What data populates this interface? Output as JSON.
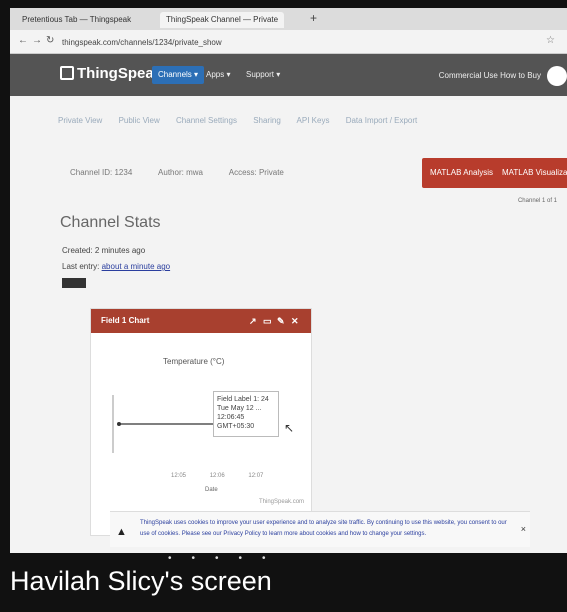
{
  "browser": {
    "tabs": [
      {
        "label": "Pretentious Tab — Thingspeak",
        "active": false
      },
      {
        "label": "ThingSpeak Channel — Private",
        "active": true
      }
    ],
    "new_tab_label": "+",
    "url": "thingspeak.com/channels/1234/private_show"
  },
  "appbar": {
    "logo": "ThingSpeak™",
    "channels_label": "Channels ▾",
    "apps_label": "Apps ▾",
    "support_label": "Support ▾",
    "commercial_label": "Commercial Use   How to Buy"
  },
  "subtabs": [
    "Private View",
    "Public View",
    "Channel Settings",
    "Sharing",
    "API Keys",
    "Data Import / Export"
  ],
  "channel_info": [
    "Channel ID: 1234",
    "Author: mwa",
    "Access: Private"
  ],
  "buttons": {
    "matlab_analysis": "MATLAB Analysis",
    "matlab_visualization": "MATLAB Visualization"
  },
  "export_label": "Channel 1 of 1",
  "stats": {
    "title": "Channel Stats",
    "created_label": "Created:",
    "created_value": "2 minutes ago",
    "entries_label": "Last entry:",
    "entries_value": "about a minute ago"
  },
  "widget": {
    "title": "Field 1 Chart",
    "chart_title": "Temperature (°C)",
    "x_label": "Date",
    "credit": "ThingSpeak.com",
    "x_ticks": [
      "12:05",
      "12:06",
      "12:07"
    ],
    "tooltip": {
      "line1": "Field Label 1: 24",
      "line2": "Tue May 12 ...",
      "line3": "12:06:45 GMT+05:30"
    }
  },
  "notice": {
    "text": "ThingSpeak uses cookies to improve your user experience and to analyze site traffic. By continuing to use this website, you consent to our use of cookies. Please see our Privacy Policy to learn more about cookies and how to change your settings."
  },
  "caption": "Havilah Slicy's screen",
  "colors": {
    "appbar": "#545454",
    "channels_menu": "#2c6fb6",
    "matlab_button": "#b83c2c",
    "widget_header": "#a8402f"
  }
}
